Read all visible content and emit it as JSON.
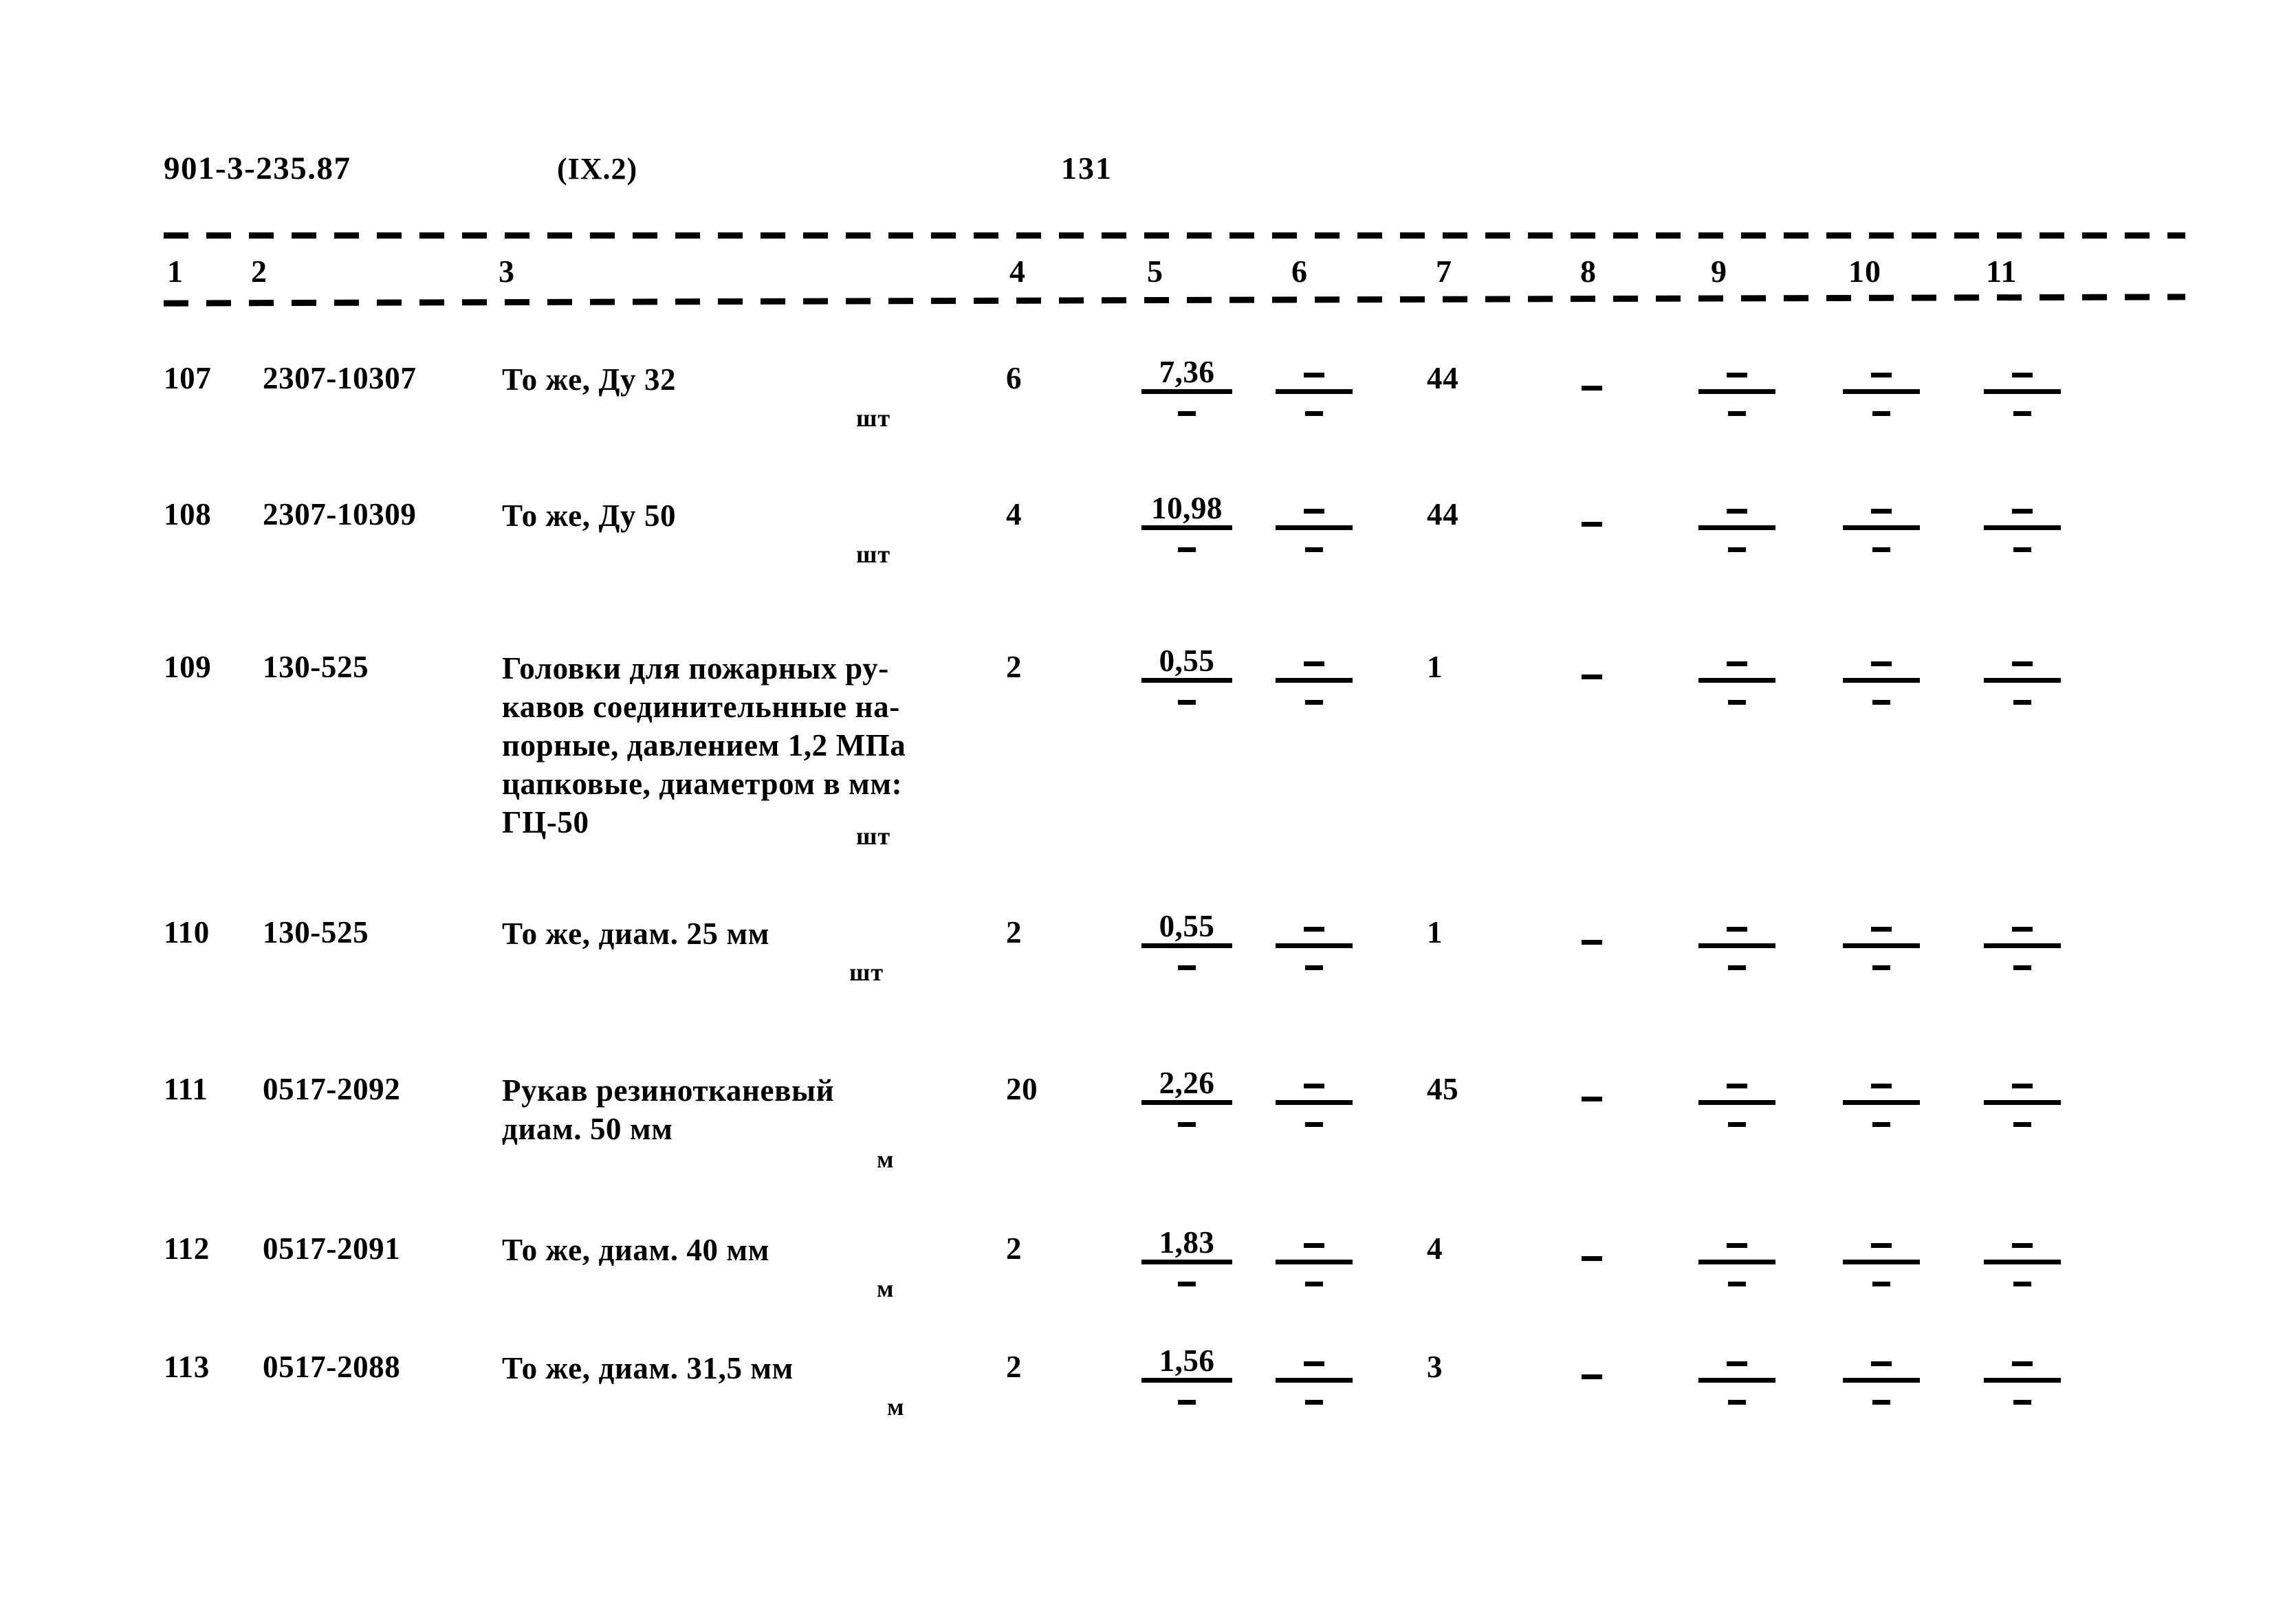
{
  "document": {
    "code": "901-3-235.87",
    "section": "(IX.2)",
    "page_number": "131"
  },
  "table": {
    "column_headers": [
      "1",
      "2",
      "3",
      "4",
      "5",
      "6",
      "7",
      "8",
      "9",
      "10",
      "11"
    ],
    "rows": [
      {
        "num": "107",
        "code": "2307-10307",
        "description": "То же, Ду 32",
        "unit": "шт",
        "qty": "6",
        "col5": {
          "num": "7,36",
          "den": "-"
        },
        "col6": {
          "num": "-",
          "den": "-"
        },
        "col7": "44",
        "col8": "-",
        "col9": {
          "num": "-",
          "den": "-"
        },
        "col10": {
          "num": "-",
          "den": "-"
        },
        "col11": {
          "num": "-",
          "den": "-"
        }
      },
      {
        "num": "108",
        "code": "2307-10309",
        "description": "То же, Ду 50",
        "unit": "шт",
        "qty": "4",
        "col5": {
          "num": "10,98",
          "den": "-"
        },
        "col6": {
          "num": "-",
          "den": "-"
        },
        "col7": "44",
        "col8": "-",
        "col9": {
          "num": "-",
          "den": "-"
        },
        "col10": {
          "num": "-",
          "den": "-"
        },
        "col11": {
          "num": "-",
          "den": "-"
        }
      },
      {
        "num": "109",
        "code": "130-525",
        "description": "Головки для пожарных ру-\nкавов соединительнные на-\nпорные, давлением 1,2 МПа\nцапковые, диаметром в мм:\nГЦ-50",
        "unit": "шт",
        "qty": "2",
        "col5": {
          "num": "0,55",
          "den": "-"
        },
        "col6": {
          "num": "-",
          "den": "-"
        },
        "col7": "1",
        "col8": "-",
        "col9": {
          "num": "-",
          "den": "-"
        },
        "col10": {
          "num": "-",
          "den": "-"
        },
        "col11": {
          "num": "-",
          "den": "-"
        }
      },
      {
        "num": "110",
        "code": "130-525",
        "description": "То же, диам. 25 мм",
        "unit": "шт",
        "qty": "2",
        "col5": {
          "num": "0,55",
          "den": "-"
        },
        "col6": {
          "num": "-",
          "den": "-"
        },
        "col7": "1",
        "col8": "-",
        "col9": {
          "num": "-",
          "den": "-"
        },
        "col10": {
          "num": "-",
          "den": "-"
        },
        "col11": {
          "num": "-",
          "den": "-"
        }
      },
      {
        "num": "111",
        "code": "0517-2092",
        "description": "Рукав резинотканевый\nдиам. 50 мм",
        "unit": "м",
        "qty": "20",
        "col5": {
          "num": "2,26",
          "den": "-"
        },
        "col6": {
          "num": "-",
          "den": "-"
        },
        "col7": "45",
        "col8": "-",
        "col9": {
          "num": "-",
          "den": "-"
        },
        "col10": {
          "num": "-",
          "den": "-"
        },
        "col11": {
          "num": "-",
          "den": "-"
        }
      },
      {
        "num": "112",
        "code": "0517-2091",
        "description": "То же, диам. 40 мм",
        "unit": "м",
        "qty": "2",
        "col5": {
          "num": "1,83",
          "den": "-"
        },
        "col6": {
          "num": "-",
          "den": "-"
        },
        "col7": "4",
        "col8": "-",
        "col9": {
          "num": "-",
          "den": "-"
        },
        "col10": {
          "num": "-",
          "den": "-"
        },
        "col11": {
          "num": "-",
          "den": "-"
        }
      },
      {
        "num": "113",
        "code": "0517-2088",
        "description": "То же, диам. 31,5 мм",
        "unit": "м",
        "qty": "2",
        "col5": {
          "num": "1,56",
          "den": "-"
        },
        "col6": {
          "num": "-",
          "den": "-"
        },
        "col7": "3",
        "col8": "-",
        "col9": {
          "num": "-",
          "den": "-"
        },
        "col10": {
          "num": "-",
          "den": "-"
        },
        "col11": {
          "num": "-",
          "den": "-"
        }
      }
    ]
  },
  "layout": {
    "col_x": {
      "num": 238,
      "code": 382,
      "desc": 730,
      "qty": 1463,
      "col5": 1660,
      "col6": 1855,
      "col7": 2075,
      "col8": 2300,
      "col9": 2470,
      "col10": 2680,
      "col11": 2885
    },
    "header_x": [
      243,
      365,
      725,
      1468,
      1668,
      1878,
      2088,
      2298,
      2488,
      2688,
      2888
    ],
    "row_y": [
      524,
      722,
      944,
      1330,
      1558,
      1790,
      1962
    ],
    "unit_x": [
      1245,
      1245,
      1245,
      1235,
      1275,
      1275,
      1290
    ],
    "unit_y": [
      582,
      780,
      1190,
      1388,
      1660,
      1848,
      2020
    ]
  }
}
